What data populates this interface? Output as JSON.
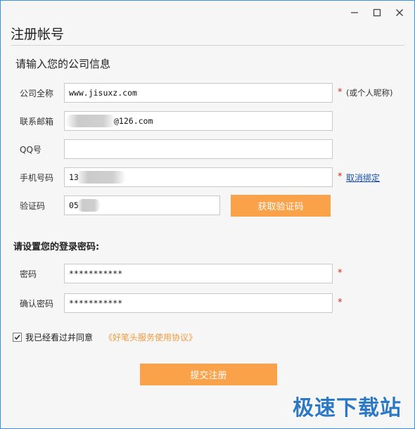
{
  "window": {
    "title": "注册帐号",
    "controls": {
      "minimize": "—",
      "maximize": "☐",
      "close": "✕"
    }
  },
  "company_section": {
    "heading": "请输入您的公司信息",
    "fields": {
      "company": {
        "label": "公司全称",
        "value": "www.jisuxz.com",
        "required": "*",
        "note": "(或个人昵称)"
      },
      "email": {
        "label": "联系邮箱",
        "value": "@126.com"
      },
      "qq": {
        "label": "QQ号",
        "value": ""
      },
      "phone": {
        "label": "手机号码",
        "value": "13",
        "required": "*",
        "link": "取消绑定"
      },
      "captcha": {
        "label": "验证码",
        "value": "05",
        "button": "获取验证码"
      }
    }
  },
  "password_section": {
    "heading": "请设置您的登录密码:",
    "fields": {
      "password": {
        "label": "密码",
        "value": "***********",
        "required": "*"
      },
      "confirm": {
        "label": "确认密码",
        "value": "***********",
        "required": "*"
      }
    }
  },
  "agreement": {
    "checked": true,
    "text": "我已经看过并同意",
    "link": "《好笔头服务使用协议》"
  },
  "submit": {
    "label": "提交注册"
  },
  "watermark": "极速下载站",
  "colors": {
    "accent_orange": "#f9a24a",
    "link_blue": "#1a4fb3",
    "required_red": "#d9261c",
    "watermark_blue": "#2c78c4"
  }
}
